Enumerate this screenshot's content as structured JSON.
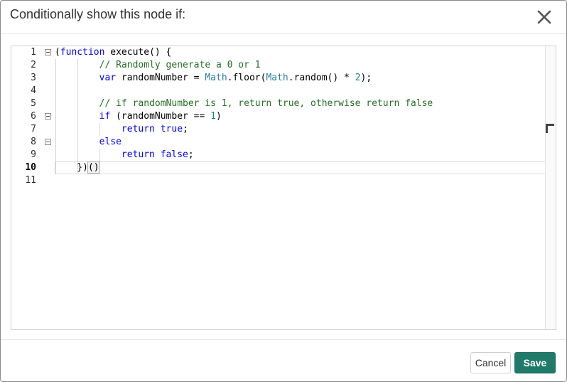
{
  "dialog": {
    "title": "Conditionally show this node if:",
    "close_icon": "close-icon",
    "accent_color": "#1f7a69"
  },
  "editor": {
    "active_line": 10,
    "lines": [
      {
        "num": "1",
        "foldable": true
      },
      {
        "num": "2",
        "foldable": false
      },
      {
        "num": "3",
        "foldable": false
      },
      {
        "num": "4",
        "foldable": false
      },
      {
        "num": "5",
        "foldable": false
      },
      {
        "num": "6",
        "foldable": true
      },
      {
        "num": "7",
        "foldable": false
      },
      {
        "num": "8",
        "foldable": true
      },
      {
        "num": "9",
        "foldable": false
      },
      {
        "num": "10",
        "foldable": false
      },
      {
        "num": "11",
        "foldable": false
      }
    ],
    "code": {
      "l1": {
        "paren": "(",
        "kw": "function",
        "rest": " execute() {"
      },
      "l2": {
        "indent": "        ",
        "comment": "// Randomly generate a 0 or 1"
      },
      "l3": {
        "indent": "        ",
        "kw": "var",
        "a": " randomNumber = ",
        "t1": "Math",
        "b": ".floor(",
        "t2": "Math",
        "c": ".random() * ",
        "n": "2",
        "d": ");"
      },
      "l5": {
        "indent": "        ",
        "comment": "// if randomNumber is 1, return true, otherwise return false"
      },
      "l6": {
        "indent": "        ",
        "kw": "if",
        "a": " (randomNumber == ",
        "n": "1",
        "b": ")"
      },
      "l7": {
        "indent": "            ",
        "kw": "return",
        "sp": " ",
        "kw2": "true",
        "b": ";"
      },
      "l8": {
        "indent": "        ",
        "kw": "else"
      },
      "l9": {
        "indent": "            ",
        "kw": "return",
        "sp": " ",
        "kw2": "false",
        "b": ";"
      },
      "l10": {
        "indent": "    ",
        "a": "})",
        "bm": "()"
      }
    }
  },
  "footer": {
    "cancel_label": "Cancel",
    "save_label": "Save"
  }
}
